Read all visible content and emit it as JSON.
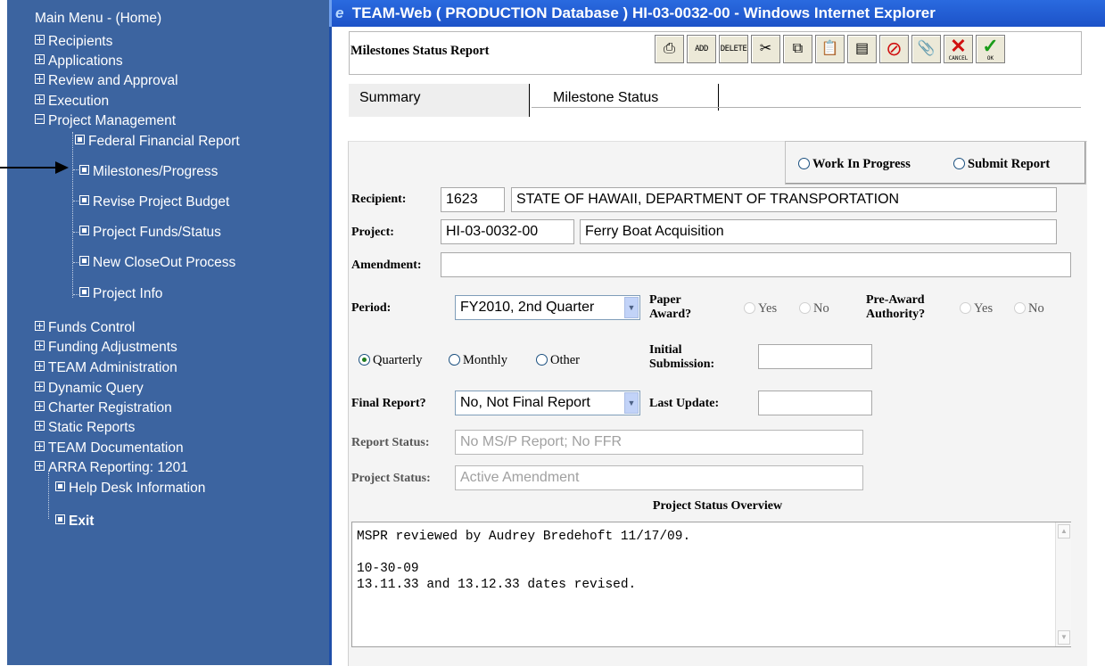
{
  "nav": {
    "items": [
      {
        "label": "Main Menu - (Home)"
      },
      {
        "label": "Recipients"
      },
      {
        "label": "Applications"
      },
      {
        "label": "Review and Approval"
      },
      {
        "label": "Execution"
      },
      {
        "label": "Project Management"
      },
      {
        "label": "Federal Financial Report"
      },
      {
        "label": "Milestones/Progress"
      },
      {
        "label": "Revise Project Budget"
      },
      {
        "label": "Project Funds/Status"
      },
      {
        "label": "New CloseOut Process"
      },
      {
        "label": "Project Info"
      },
      {
        "label": "Funds Control"
      },
      {
        "label": "Funding Adjustments"
      },
      {
        "label": "TEAM Administration"
      },
      {
        "label": "Dynamic Query"
      },
      {
        "label": "Charter Registration"
      },
      {
        "label": "Static Reports"
      },
      {
        "label": "TEAM Documentation"
      },
      {
        "label": "ARRA Reporting: 1201"
      },
      {
        "label": "Help Desk Information"
      },
      {
        "label": "Exit"
      }
    ]
  },
  "window": {
    "title": "TEAM-Web ( PRODUCTION Database ) HI-03-0032-00 - Windows Internet Explorer"
  },
  "toolbar": {
    "title": "Milestones Status Report",
    "add_label": "ADD",
    "delete_label": "DELETE",
    "cancel_label": "CANCEL",
    "ok_label": "OK"
  },
  "tabs": [
    {
      "label": "Summary",
      "active": true
    },
    {
      "label": "Milestone Status",
      "active": false
    }
  ],
  "form": {
    "status_options": [
      "Work In Progress",
      "Submit Report"
    ],
    "recipient_label": "Recipient:",
    "recipient_id": "1623",
    "recipient_name": "STATE OF HAWAII, DEPARTMENT OF TRANSPORTATION",
    "project_label": "Project:",
    "project_id": "HI-03-0032-00",
    "project_name": "Ferry Boat Acquisition",
    "amendment_label": "Amendment:",
    "amendment_value": "",
    "period_label": "Period:",
    "period_value": "FY2010, 2nd Quarter",
    "paper_award_label_1": "Paper",
    "paper_award_label_2": "Award?",
    "pre_award_label_1": "Pre-Award",
    "pre_award_label_2": "Authority?",
    "yes_label": "Yes",
    "no_label": "No",
    "frequency_options": [
      "Quarterly",
      "Monthly",
      "Other"
    ],
    "frequency_selected": "Quarterly",
    "initial_submission_label_1": "Initial",
    "initial_submission_label_2": "Submission:",
    "initial_submission_value": "",
    "final_report_label": "Final Report?",
    "final_report_value": "No, Not Final Report",
    "last_update_label": "Last Update:",
    "last_update_value": "",
    "report_status_label": "Report Status:",
    "report_status_value": "No MS/P Report; No FFR",
    "project_status_label": "Project Status:",
    "project_status_value": "Active Amendment",
    "overview_title": "Project Status Overview",
    "overview_text": "MSPR reviewed by Audrey Bredehoft 11/17/09.\n\n10-30-09\n13.11.33 and 13.12.33 dates revised."
  },
  "colors": {
    "nav_bg": "#3c64a0",
    "titlebar": "#1c52c8",
    "panel_bg": "#f4f4f4"
  }
}
